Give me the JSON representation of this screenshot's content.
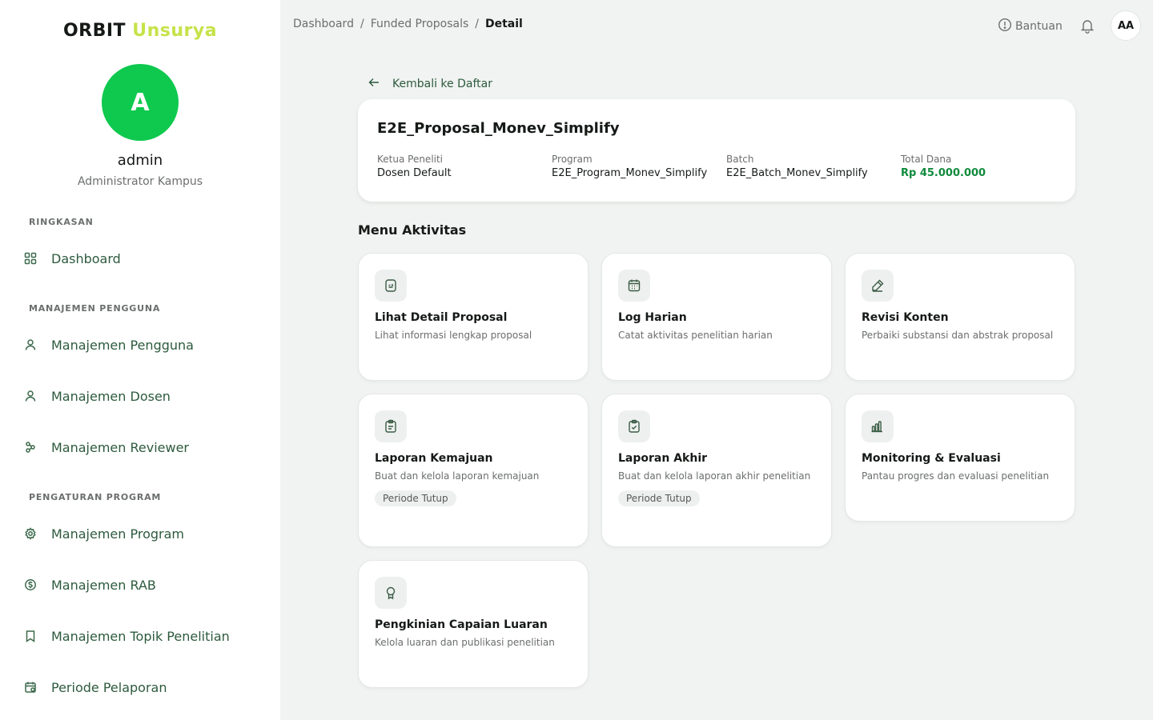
{
  "brand": {
    "part1": "ORBIT",
    "part2": "Unsurya"
  },
  "user": {
    "initial": "A",
    "name": "admin",
    "role": "Administrator Kampus"
  },
  "sidebar": {
    "sections": [
      {
        "title": "RINGKASAN"
      },
      {
        "title": "MANAJEMEN PENGGUNA"
      },
      {
        "title": "PENGATURAN PROGRAM"
      }
    ],
    "items": [
      {
        "label": "Dashboard",
        "icon": "grid-icon"
      },
      {
        "label": "Manajemen Pengguna",
        "icon": "user-icon"
      },
      {
        "label": "Manajemen Dosen",
        "icon": "user-icon"
      },
      {
        "label": "Manajemen Reviewer",
        "icon": "users-network-icon"
      },
      {
        "label": "Manajemen Program",
        "icon": "gear-icon"
      },
      {
        "label": "Manajemen RAB",
        "icon": "money-icon"
      },
      {
        "label": "Manajemen Topik Penelitian",
        "icon": "bookmark-icon"
      },
      {
        "label": "Periode Pelaporan",
        "icon": "calendar-icon"
      }
    ]
  },
  "header": {
    "breadcrumb": [
      "Dashboard",
      "Funded Proposals",
      "Detail"
    ],
    "separator": "/",
    "help_label": "Bantuan",
    "avatar_initials": "AA"
  },
  "back_label": "Kembali ke Daftar",
  "proposal": {
    "title": "E2E_Proposal_Monev_Simplify",
    "meta": [
      {
        "label": "Ketua Peneliti",
        "value": "Dosen Default"
      },
      {
        "label": "Program",
        "value": "E2E_Program_Monev_Simplify"
      },
      {
        "label": "Batch",
        "value": "E2E_Batch_Monev_Simplify"
      },
      {
        "label": "Total Dana",
        "value": "Rp 45.000.000"
      }
    ]
  },
  "menu_title": "Menu Aktivitas",
  "activities": [
    {
      "title": "Lihat Detail Proposal",
      "desc": "Lihat informasi lengkap proposal",
      "icon": "document-icon"
    },
    {
      "title": "Log Harian",
      "desc": "Catat aktivitas penelitian harian",
      "icon": "calendar-icon"
    },
    {
      "title": "Revisi Konten",
      "desc": "Perbaiki substansi dan abstrak proposal",
      "icon": "pencil-icon"
    },
    {
      "title": "Laporan Kemajuan",
      "desc": "Buat dan kelola laporan kemajuan",
      "icon": "clipboard-icon",
      "badge": "Periode Tutup"
    },
    {
      "title": "Laporan Akhir",
      "desc": "Buat dan kelola laporan akhir penelitian",
      "icon": "clipboard-check-icon",
      "badge": "Periode Tutup"
    },
    {
      "title": "Monitoring & Evaluasi",
      "desc": "Pantau progres dan evaluasi penelitian",
      "icon": "bar-chart-icon"
    },
    {
      "title": "Pengkinian Capaian Luaran",
      "desc": "Kelola luaran dan publikasi penelitian",
      "icon": "award-icon"
    }
  ]
}
